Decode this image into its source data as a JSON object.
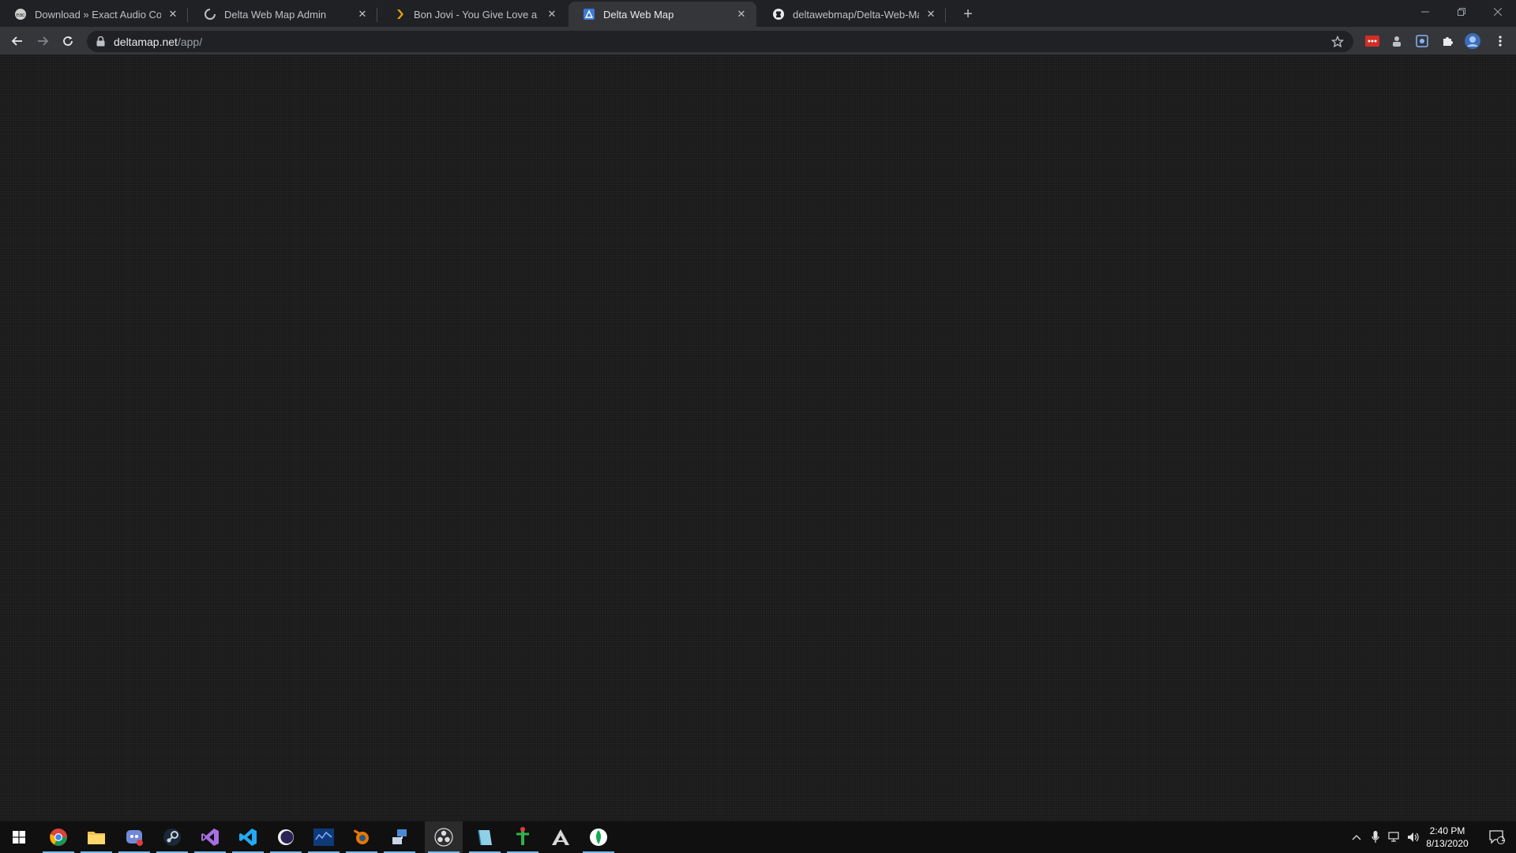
{
  "browser": {
    "tabs": [
      {
        "title": "Download » Exact Audio Copy",
        "favicon": "eac-icon",
        "active": false
      },
      {
        "title": "Delta Web Map Admin",
        "favicon": "loading-spinner-icon",
        "active": false
      },
      {
        "title": "Bon Jovi - You Give Love a Bad N",
        "favicon": "plex-chevron-icon",
        "active": false
      },
      {
        "title": "Delta Web Map",
        "favicon": "delta-icon",
        "active": true
      },
      {
        "title": "deltawebmap/Delta-Web-Map-F",
        "favicon": "github-icon",
        "active": false
      }
    ],
    "new_tab_label": "+",
    "address": {
      "host": "deltamap.net",
      "path": "/app/"
    },
    "extensions": [
      "lastpass-icon",
      "extension-person-icon",
      "screenshot-icon",
      "puzzle-icon",
      "profile-avatar-icon",
      "menu-icon"
    ]
  },
  "page": {
    "background": "#1a1a1a"
  },
  "taskbar": {
    "apps": [
      "chrome-icon",
      "file-explorer-icon",
      "discord-icon",
      "steam-icon",
      "visual-studio-icon",
      "vscode-icon",
      "eclipse-icon",
      "terminal-icon",
      "blender-icon",
      "network-icon",
      "obs-icon",
      "notepad-icon",
      "sourcetree-icon",
      "ark-icon",
      "mongodb-icon"
    ],
    "clock": {
      "time": "2:40 PM",
      "date": "8/13/2020"
    },
    "notification_count": "1"
  },
  "colors": {
    "tabstrip": "#202124",
    "toolbar": "#35363a",
    "taskbar": "#101010",
    "accent": "#76b9ed"
  }
}
